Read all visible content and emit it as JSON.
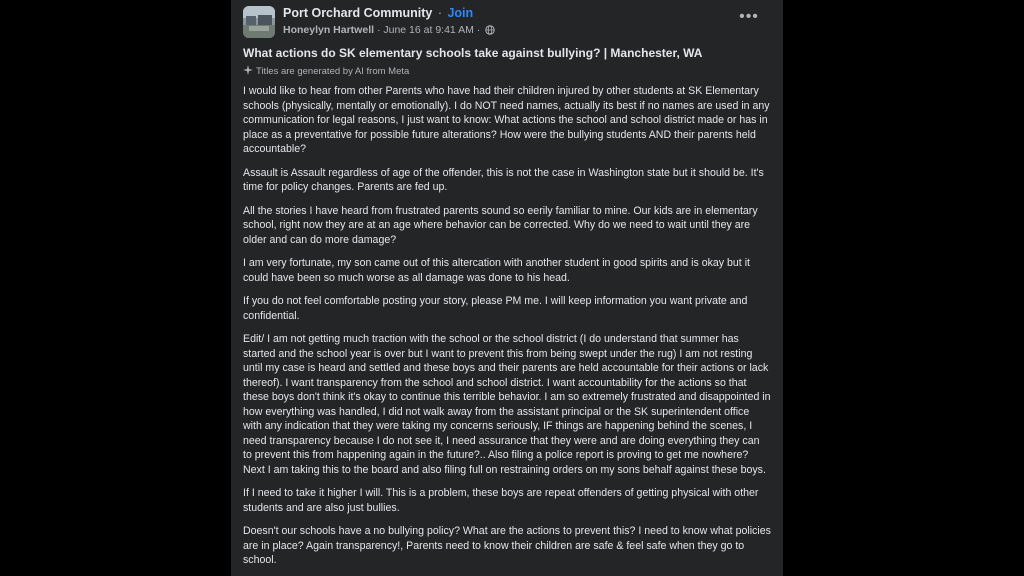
{
  "post": {
    "group_name": "Port Orchard Community",
    "separator": "·",
    "join_label": "Join",
    "author": "Honeylyn Hartwell",
    "timestamp": "June 16 at 9:41 AM",
    "privacy_icon": "globe-icon",
    "more_icon": "more-options-icon",
    "more_label": "•••",
    "title": "What actions do SK elementary schools take against bullying? | Manchester, WA",
    "ai_note": "Titles are generated by AI from Meta",
    "paragraphs": [
      "I would like to hear from other Parents who have had their children injured by other students at SK Elementary schools (physically, mentally or emotionally). I do NOT need names, actually its best if no names are used in any communication for legal reasons, I just want to know: What actions the school and school district made or has in place as a preventative for possible future alterations? How were the bullying students AND their parents held accountable?",
      "Assault is Assault regardless of age of the offender, this is not the case in Washington state but it should be. It's time for policy changes. Parents are fed up.",
      "All the stories I have heard from frustrated parents sound so eerily familiar to mine. Our kids are in elementary school, right now they are at an age where behavior can be corrected. Why do we need to wait until they are older and can do more damage?",
      "I am very fortunate, my son came out of this altercation with another student in good spirits and is okay but it could have been so much worse as all damage was done to his head.",
      "If you do not feel comfortable posting your story, please PM me. I will keep information you want private and confidential.",
      "Edit/ I am not getting much traction with the school or the school district (I do understand that summer has started and the school year is over but I want to prevent this from being swept under the rug) I am not resting until my case is heard and settled and these boys and their parents are held accountable for their actions or lack thereof). I want transparency from the school and school district. I want accountability for the actions so that these boys don't think it's okay to continue this terrible behavior. I am so extremely frustrated and disappointed in how everything was handled, I did not walk away from the assistant principal or the SK superintendent office with any indication that they were taking my concerns seriously, IF things are happening behind the scenes, I need transparency because I do not see it, I need assurance that they were and are doing everything they can to prevent this from happening again in the future?.. Also filing a police report is proving to get me nowhere?  Next I am taking this to the board and also filing full on restraining orders on my sons behalf against these boys.",
      "If I need to take it higher I will. This is a problem, these boys are repeat offenders of getting physical with other students and are also just bullies.",
      "Doesn't our schools have a no bullying policy? What are the actions to prevent this? I need to know what policies are in place? Again transparency!, Parents need to know their children are safe & feel safe when they go to school."
    ]
  },
  "colors": {
    "background": "#000000",
    "card": "#242526",
    "text_primary": "#e4e6eb",
    "text_secondary": "#b0b3b8",
    "link_blue": "#2d88ff"
  }
}
